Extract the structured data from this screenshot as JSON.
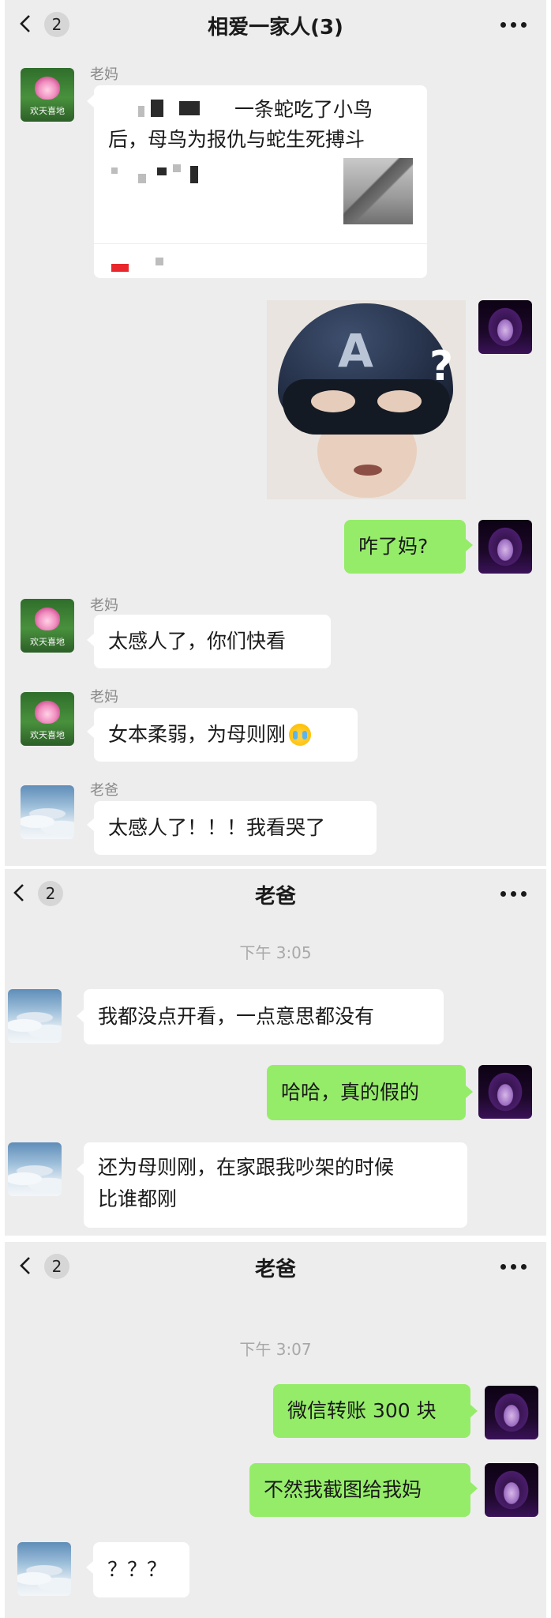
{
  "panel1": {
    "badge": "2",
    "title": "相爱一家人(3)",
    "messages": {
      "m1": {
        "sender": "老妈",
        "share_title_line1": "一条蛇吃了小鸟",
        "share_title_line2": "后，母鸟为报仇与蛇生死搏斗"
      },
      "m2": {
        "sticker": "question-face-sticker"
      },
      "m3": {
        "text": "咋了妈?"
      },
      "m4": {
        "sender": "老妈",
        "text": "太感人了，你们快看"
      },
      "m5": {
        "sender": "老妈",
        "text": "女本柔弱，为母则刚"
      },
      "m6": {
        "sender": "老爸",
        "text": "太感人了！！！我看哭了"
      }
    },
    "avatar_caption": "欢天喜地"
  },
  "panel2": {
    "badge": "2",
    "title": "老爸",
    "timestamp": "下午 3:05",
    "messages": {
      "m1": {
        "text": "我都没点开看，一点意思都没有"
      },
      "m2": {
        "text": "哈哈，真的假的"
      },
      "m3": {
        "line1": "还为母则刚，在家跟我吵架的时候",
        "line2": "比谁都刚"
      }
    }
  },
  "panel3": {
    "badge": "2",
    "title": "老爸",
    "timestamp": "下午 3:07",
    "messages": {
      "m1": {
        "text": "微信转账 300 块"
      },
      "m2": {
        "text": "不然我截图给我妈"
      },
      "m3": {
        "text": "？？？"
      }
    }
  },
  "colors": {
    "chat_bg": "#ededed",
    "sent_bubble": "#95ec69",
    "received_bubble": "#ffffff",
    "timestamp": "#a8a8a8"
  },
  "icons": [
    "back-chevron-icon",
    "more-dots-icon",
    "crying-face-emoji"
  ]
}
